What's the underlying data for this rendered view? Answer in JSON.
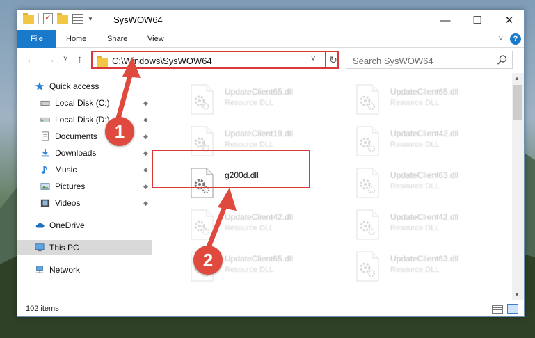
{
  "window": {
    "title": "SysWOW64",
    "minimize_glyph": "—",
    "maximize_glyph": "☐",
    "close_glyph": "✕"
  },
  "ribbon": {
    "tabs": [
      "File",
      "Home",
      "Share",
      "View"
    ],
    "help_glyph": "?"
  },
  "navigation": {
    "back_glyph": "←",
    "forward_glyph": "→",
    "recent_glyph": "˅",
    "up_glyph": "↑",
    "address": "C:\\Windows\\SysWOW64",
    "address_dropdown_glyph": "˅",
    "refresh_glyph": "↻",
    "search_placeholder": "Search SysWOW64"
  },
  "sidebar": {
    "items": [
      {
        "label": "Quick access",
        "icon": "star-icon"
      },
      {
        "label": "Local Disk (C:)",
        "icon": "drive-icon",
        "pinned": true
      },
      {
        "label": "Local Disk (D:)",
        "icon": "drive-icon",
        "pinned": true
      },
      {
        "label": "Documents",
        "icon": "documents-icon",
        "pinned": true
      },
      {
        "label": "Downloads",
        "icon": "downloads-icon",
        "pinned": true
      },
      {
        "label": "Music",
        "icon": "music-icon",
        "pinned": true
      },
      {
        "label": "Pictures",
        "icon": "pictures-icon",
        "pinned": true
      },
      {
        "label": "Videos",
        "icon": "videos-icon",
        "pinned": true
      },
      {
        "label": "OneDrive",
        "icon": "cloud-icon"
      },
      {
        "label": "This PC",
        "icon": "computer-icon",
        "selected": true
      },
      {
        "label": "Network",
        "icon": "network-icon"
      }
    ],
    "pin_glyph": "📌"
  },
  "files": [
    {
      "name": "UpdateClient65.dll",
      "type": "Resource DLL",
      "faded": true
    },
    {
      "name": "UpdateClient65.dll",
      "type": "Resource DLL",
      "faded": true
    },
    {
      "name": "UpdateClient19.dll",
      "type": "Resource DLL",
      "faded": true
    },
    {
      "name": "UpdateClient42.dll",
      "type": "Resource DLL",
      "faded": true
    },
    {
      "name": "g200d.dll",
      "type": "",
      "faded": false
    },
    {
      "name": "UpdateClient63.dll",
      "type": "Resource DLL",
      "faded": true
    },
    {
      "name": "UpdateClient42.dll",
      "type": "Resource DLL",
      "faded": true
    },
    {
      "name": "UpdateClient42.dll",
      "type": "Resource DLL",
      "faded": true
    },
    {
      "name": "UpdateClient65.dll",
      "type": "Resource DLL",
      "faded": true
    },
    {
      "name": "UpdateClient63.dll",
      "type": "Resource DLL",
      "faded": true
    }
  ],
  "status": {
    "item_count": "102 items"
  },
  "annotations": {
    "step1": "1",
    "step2": "2",
    "color": "#e04a3e"
  },
  "colors": {
    "accent": "#1979ca",
    "highlight_border": "#d9393a",
    "selected_bg": "#d9d9d9"
  }
}
